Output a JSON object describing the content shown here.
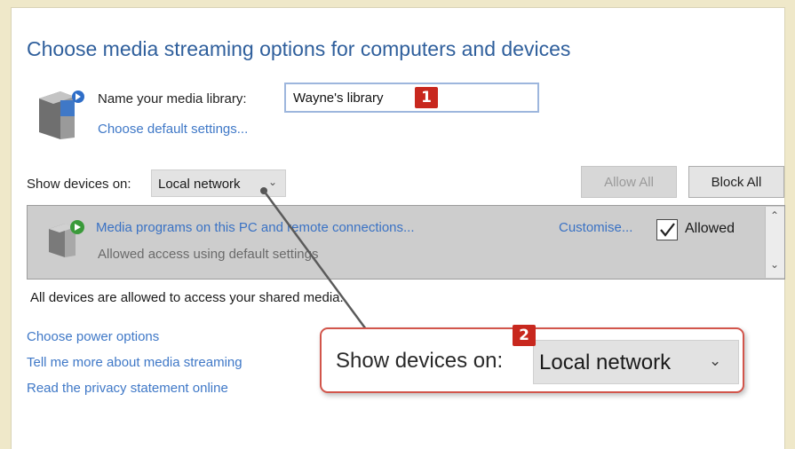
{
  "header": {
    "title": "Choose media streaming options for computers and devices"
  },
  "library": {
    "label": "Name your media library:",
    "name_value": "Wayne's library",
    "default_settings_link": "Choose default settings..."
  },
  "badges": {
    "one": "1",
    "two": "2"
  },
  "devices_filter": {
    "label": "Show devices on:",
    "selected": "Local network"
  },
  "buttons": {
    "allow_all": "Allow All",
    "block_all": "Block All"
  },
  "device_list": {
    "items": [
      {
        "name": "Media programs on this PC and remote connections...",
        "status": "Allowed access using default settings",
        "customise_link": "Customise...",
        "allowed_label": "Allowed",
        "allowed": true
      }
    ]
  },
  "summary": {
    "text": "All devices are allowed to access your shared media."
  },
  "links": {
    "power": "Choose power options",
    "streaming": "Tell me more about media streaming",
    "privacy": "Read the privacy statement online"
  },
  "zoom_callout": {
    "label": "Show devices on:",
    "selected": "Local network"
  },
  "colors": {
    "title_blue": "#2f5f9c",
    "link_blue": "#3f78c7",
    "badge_red": "#c8281e",
    "callout_border": "#d2554b",
    "background_cream": "#efe8c9"
  },
  "icons": {
    "library": "media-library-icon",
    "device": "media-device-icon",
    "checkbox": "checkmark-icon",
    "dropdown": "chevron-down-icon"
  }
}
